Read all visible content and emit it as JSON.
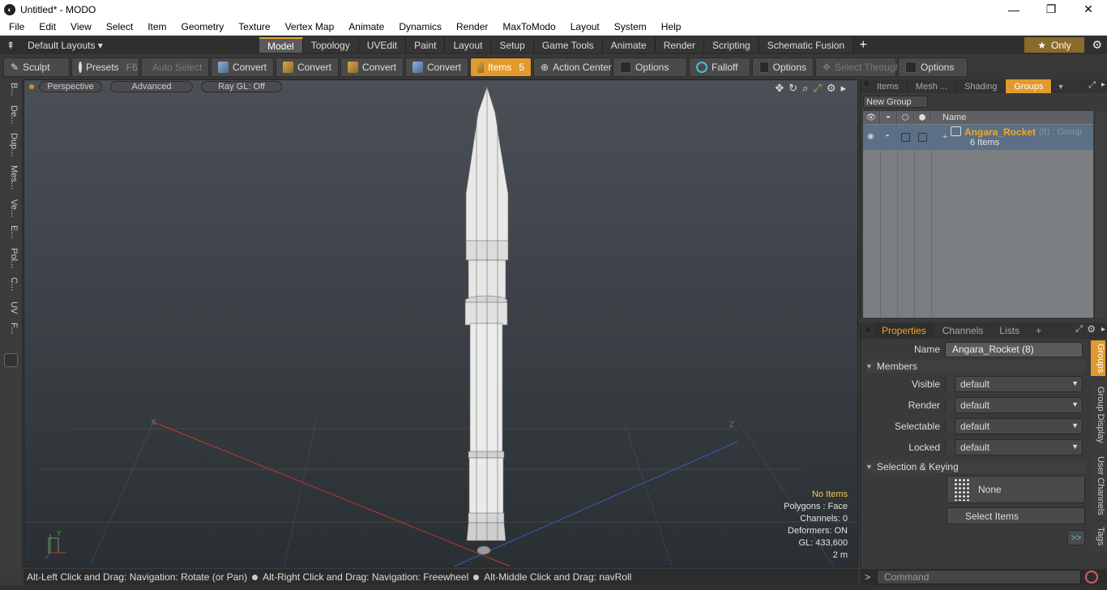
{
  "window": {
    "title": "Untitled* - MODO",
    "minimize_glyph": "—",
    "restore_glyph": "❐",
    "close_glyph": "✕"
  },
  "menu": [
    "File",
    "Edit",
    "View",
    "Select",
    "Item",
    "Geometry",
    "Texture",
    "Vertex Map",
    "Animate",
    "Dynamics",
    "Render",
    "MaxToModo",
    "Layout",
    "System",
    "Help"
  ],
  "layout_bar": {
    "selector": "Default Layouts ▾",
    "tabs": [
      "Model",
      "Topology",
      "UVEdit",
      "Paint",
      "Layout",
      "Setup",
      "Game Tools",
      "Animate",
      "Render",
      "Scripting",
      "Schematic Fusion"
    ],
    "active_tab": "Model",
    "plus": "+",
    "only": "Only",
    "star": "★"
  },
  "toolbar": {
    "sculpt": "Sculpt",
    "presets": "Presets",
    "presets_key": "F6",
    "auto_select": "Auto Select",
    "convert1": "Convert",
    "convert2": "Convert",
    "convert3": "Convert",
    "convert4": "Convert",
    "items": "Items",
    "items_key": "5",
    "action_center": "Action Center",
    "options1": "Options",
    "falloff": "Falloff",
    "options2": "Options",
    "select_through": "Select Through",
    "options3": "Options"
  },
  "left_strip": [
    "B...",
    "De...",
    "Dup...",
    "Mes...",
    "Ve...",
    "E...",
    "Pol...",
    "C...",
    "UV",
    "F..."
  ],
  "viewport": {
    "buttons": [
      "Perspective",
      "Advanced",
      "Ray GL: Off"
    ],
    "info": {
      "selection": "No Items",
      "polygons": "Polygons : Face",
      "channels": "Channels: 0",
      "deformers": "Deformers: ON",
      "gl": "GL: 433,600",
      "scale": "2 m"
    },
    "axis_x": "X",
    "axis_z": "Z",
    "gizmo_y": "Y"
  },
  "groups_panel": {
    "tabs": [
      "Items",
      "Mesh ...",
      "Shading",
      "Groups"
    ],
    "active_tab": "Groups",
    "new_group": "New Group",
    "column_name": "Name",
    "row": {
      "name": "Angara_Rocket",
      "count": "(8)",
      "type": ": Group",
      "items": "6 Items"
    }
  },
  "properties_panel": {
    "tabs": [
      "Properties",
      "Channels",
      "Lists",
      "+"
    ],
    "active_tab": "Properties",
    "name_label": "Name",
    "name_value": "Angara_Rocket (8)",
    "members_section": "Members",
    "members": [
      {
        "label": "Visible",
        "value": "default"
      },
      {
        "label": "Render",
        "value": "default"
      },
      {
        "label": "Selectable",
        "value": "default"
      },
      {
        "label": "Locked",
        "value": "default"
      }
    ],
    "selection_section": "Selection & Keying",
    "none_label": "None",
    "select_items": "Select Items",
    "more": ">>",
    "side_tabs": [
      "Groups",
      "Group Display",
      "User Channels",
      "Tags"
    ]
  },
  "status": {
    "hint1": "Alt-Left Click and Drag: Navigation: Rotate (or Pan)",
    "hint2": "Alt-Right Click and Drag: Navigation: Freewheel",
    "hint3": "Alt-Middle Click and Drag: navRoll"
  },
  "command": {
    "placeholder": "Command",
    "caret": ">"
  }
}
